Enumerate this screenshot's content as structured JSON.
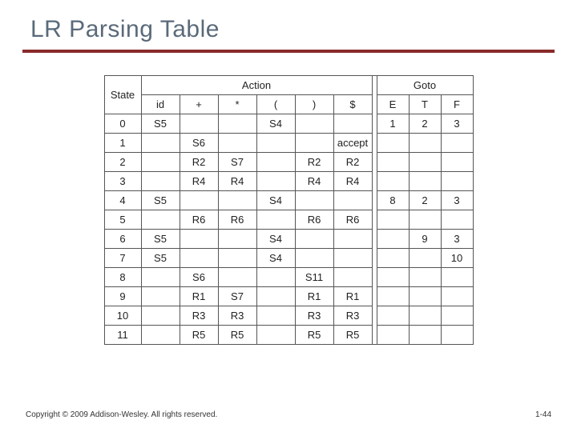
{
  "title": "LR Parsing Table",
  "headers": {
    "action": "Action",
    "goto": "Goto",
    "state": "State",
    "action_cols": [
      "id",
      "+",
      "*",
      "(",
      ")",
      "$"
    ],
    "goto_cols": [
      "E",
      "T",
      "F"
    ]
  },
  "rows": [
    {
      "state": "0",
      "action": [
        "S5",
        "",
        "",
        "S4",
        "",
        ""
      ],
      "goto": [
        "1",
        "2",
        "3"
      ]
    },
    {
      "state": "1",
      "action": [
        "",
        "S6",
        "",
        "",
        "",
        "accept"
      ],
      "goto": [
        "",
        "",
        ""
      ]
    },
    {
      "state": "2",
      "action": [
        "",
        "R2",
        "S7",
        "",
        "R2",
        "R2"
      ],
      "goto": [
        "",
        "",
        ""
      ]
    },
    {
      "state": "3",
      "action": [
        "",
        "R4",
        "R4",
        "",
        "R4",
        "R4"
      ],
      "goto": [
        "",
        "",
        ""
      ]
    },
    {
      "state": "4",
      "action": [
        "S5",
        "",
        "",
        "S4",
        "",
        ""
      ],
      "goto": [
        "8",
        "2",
        "3"
      ]
    },
    {
      "state": "5",
      "action": [
        "",
        "R6",
        "R6",
        "",
        "R6",
        "R6"
      ],
      "goto": [
        "",
        "",
        ""
      ]
    },
    {
      "state": "6",
      "action": [
        "S5",
        "",
        "",
        "S4",
        "",
        ""
      ],
      "goto": [
        "",
        "9",
        "3"
      ]
    },
    {
      "state": "7",
      "action": [
        "S5",
        "",
        "",
        "S4",
        "",
        ""
      ],
      "goto": [
        "",
        "",
        "10"
      ]
    },
    {
      "state": "8",
      "action": [
        "",
        "S6",
        "",
        "",
        "S11",
        ""
      ],
      "goto": [
        "",
        "",
        ""
      ]
    },
    {
      "state": "9",
      "action": [
        "",
        "R1",
        "S7",
        "",
        "R1",
        "R1"
      ],
      "goto": [
        "",
        "",
        ""
      ]
    },
    {
      "state": "10",
      "action": [
        "",
        "R3",
        "R3",
        "",
        "R3",
        "R3"
      ],
      "goto": [
        "",
        "",
        ""
      ]
    },
    {
      "state": "11",
      "action": [
        "",
        "R5",
        "R5",
        "",
        "R5",
        "R5"
      ],
      "goto": [
        "",
        "",
        ""
      ]
    }
  ],
  "footer": {
    "copyright": "Copyright © 2009 Addison-Wesley. All rights reserved.",
    "page": "1-44"
  }
}
